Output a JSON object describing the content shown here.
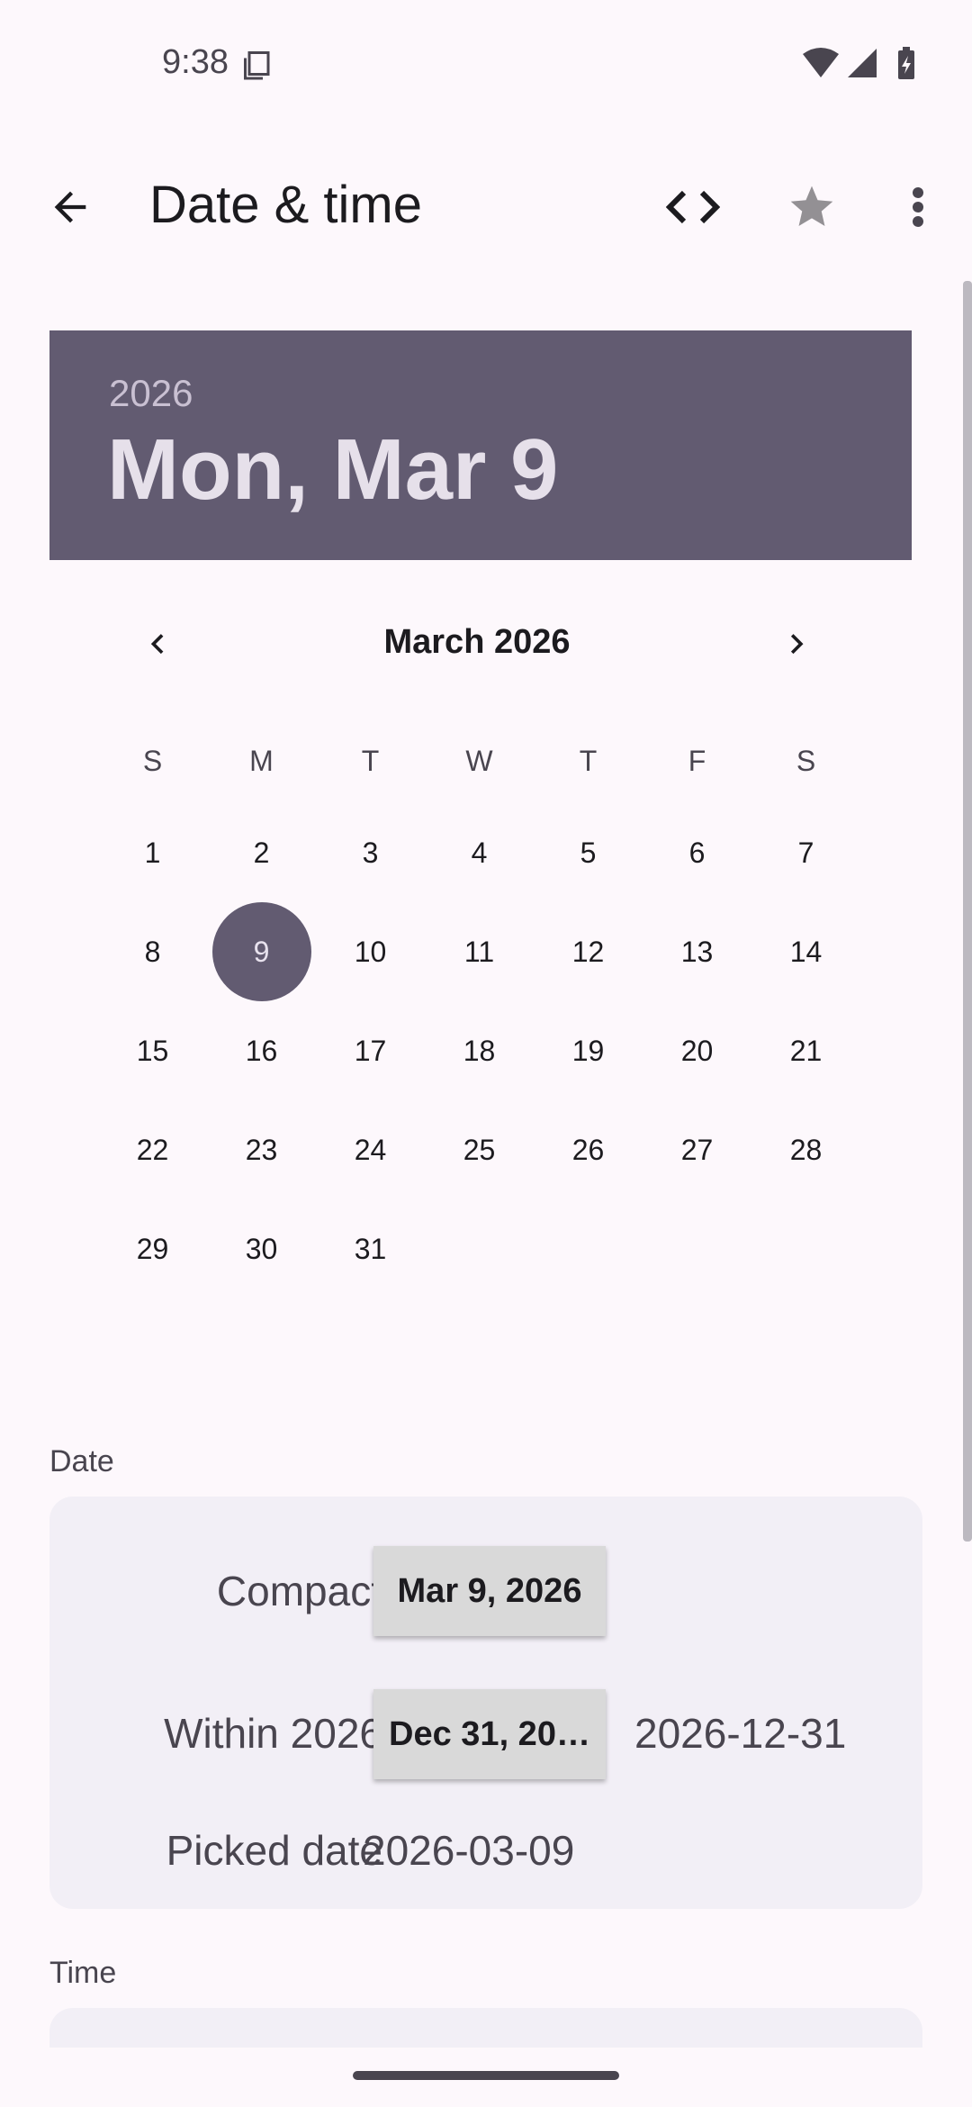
{
  "status_bar": {
    "time": "9:38"
  },
  "app_bar": {
    "title": "Date & time"
  },
  "header": {
    "year": "2026",
    "date": "Mon, Mar 9"
  },
  "calendar": {
    "month_label": "March 2026",
    "weekdays": [
      "S",
      "M",
      "T",
      "W",
      "T",
      "F",
      "S"
    ],
    "days": [
      "1",
      "2",
      "3",
      "4",
      "5",
      "6",
      "7",
      "8",
      "9",
      "10",
      "11",
      "12",
      "13",
      "14",
      "15",
      "16",
      "17",
      "18",
      "19",
      "20",
      "21",
      "22",
      "23",
      "24",
      "25",
      "26",
      "27",
      "28",
      "29",
      "30",
      "31"
    ],
    "selected_day": "9"
  },
  "date_section": {
    "label": "Date",
    "compact_label": "Compact",
    "compact_value": "Mar 9, 2026",
    "within_label": "Within 2026",
    "within_value": "Dec 31, 20…",
    "within_text": "2026-12-31",
    "picked_label": "Picked date",
    "picked_value": "2026-03-09"
  },
  "time_section": {
    "label": "Time"
  },
  "colors": {
    "accent": "#625b71",
    "background": "#fdf8fc",
    "card": "#f2eff6"
  }
}
